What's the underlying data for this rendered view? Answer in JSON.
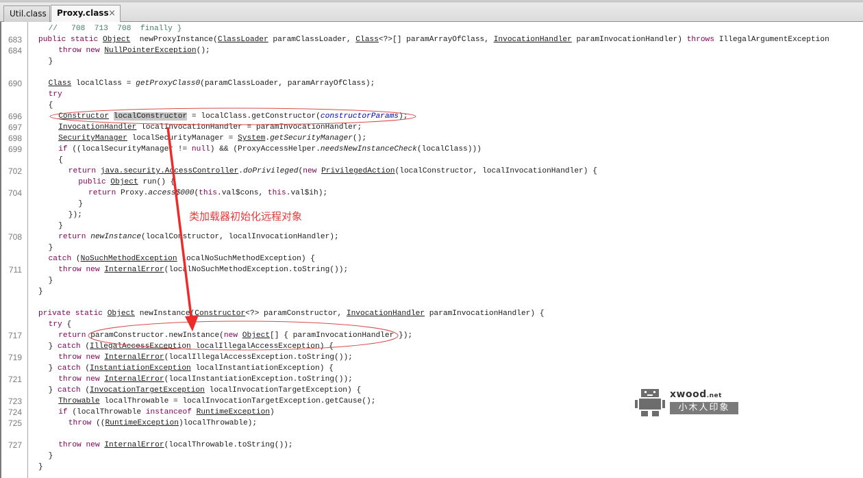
{
  "tabs": [
    {
      "label": "Util.class",
      "active": false
    },
    {
      "label": "Proxy.class",
      "active": true,
      "close_icon": "×"
    }
  ],
  "code_lines": [
    {
      "ln": "",
      "indent": 1,
      "tokens": [
        [
          "cm",
          "//   708  713  708  finally }"
        ]
      ]
    },
    {
      "ln": "683",
      "indent": 0,
      "tokens": [
        [
          "kw",
          "public static "
        ],
        [
          "ty",
          "Object"
        ],
        [
          "",
          "  newProxyInstance("
        ],
        [
          "ty",
          "ClassLoader"
        ],
        [
          "",
          " paramClassLoader, "
        ],
        [
          "ty",
          "Class"
        ],
        [
          "",
          "<?>[] paramArrayOfClass, "
        ],
        [
          "ty",
          "InvocationHandler"
        ],
        [
          "",
          " paramInvocationHandler) "
        ],
        [
          "kw",
          "throws"
        ],
        [
          "",
          " IllegalArgumentException"
        ]
      ]
    },
    {
      "ln": "684",
      "indent": 2,
      "tokens": [
        [
          "kw",
          "throw new "
        ],
        [
          "ty",
          "NullPointerException"
        ],
        [
          "",
          "();"
        ]
      ]
    },
    {
      "ln": "",
      "indent": 1,
      "tokens": [
        [
          "",
          "}"
        ]
      ]
    },
    {
      "ln": "",
      "indent": 0,
      "tokens": []
    },
    {
      "ln": "690",
      "indent": 1,
      "tokens": [
        [
          "ty",
          "Class"
        ],
        [
          "",
          " localClass = "
        ],
        [
          "it",
          "getProxyClass0"
        ],
        [
          "",
          "(paramClassLoader, paramArrayOfClass);"
        ]
      ]
    },
    {
      "ln": "",
      "indent": 1,
      "tokens": [
        [
          "kw",
          "try"
        ]
      ]
    },
    {
      "ln": "",
      "indent": 1,
      "tokens": [
        [
          "",
          "{"
        ]
      ]
    },
    {
      "ln": "696",
      "indent": 2,
      "tokens": [
        [
          "ty",
          "Constructor"
        ],
        [
          "",
          " "
        ],
        [
          "sel",
          "localConstructor"
        ],
        [
          "",
          " = localClass.getConstructor("
        ],
        [
          "fld",
          "constructorParams"
        ],
        [
          "",
          ");"
        ]
      ]
    },
    {
      "ln": "697",
      "indent": 2,
      "tokens": [
        [
          "ty",
          "InvocationHandler"
        ],
        [
          "",
          " localInvocationHandler = paramInvocationHandler;"
        ]
      ]
    },
    {
      "ln": "698",
      "indent": 2,
      "tokens": [
        [
          "ty",
          "SecurityManager"
        ],
        [
          "",
          " localSecurityManager = "
        ],
        [
          "ty",
          "System"
        ],
        [
          "",
          "."
        ],
        [
          "it",
          "getSecurityManager"
        ],
        [
          "",
          "();"
        ]
      ]
    },
    {
      "ln": "699",
      "indent": 2,
      "tokens": [
        [
          "kw",
          "if"
        ],
        [
          "",
          " ((localSecurityManager != "
        ],
        [
          "kw",
          "null"
        ],
        [
          "",
          ") && (ProxyAccessHelper."
        ],
        [
          "it",
          "needsNewInstanceCheck"
        ],
        [
          "",
          "(localClass)))"
        ]
      ]
    },
    {
      "ln": "",
      "indent": 2,
      "tokens": [
        [
          "",
          "{"
        ]
      ]
    },
    {
      "ln": "702",
      "indent": 3,
      "tokens": [
        [
          "kw",
          "return "
        ],
        [
          "ty",
          "java.security.AccessController"
        ],
        [
          "",
          "."
        ],
        [
          "it",
          "doPrivileged"
        ],
        [
          "",
          "("
        ],
        [
          "kw",
          "new "
        ],
        [
          "ty",
          "PrivilegedAction"
        ],
        [
          "",
          "(localConstructor, localInvocationHandler) {"
        ]
      ]
    },
    {
      "ln": "",
      "indent": 4,
      "tokens": [
        [
          "kw",
          "public "
        ],
        [
          "ty",
          "Object"
        ],
        [
          "",
          " run() {"
        ]
      ]
    },
    {
      "ln": "704",
      "indent": 5,
      "tokens": [
        [
          "kw",
          "return "
        ],
        [
          "",
          "Proxy."
        ],
        [
          "it",
          "access$000"
        ],
        [
          "",
          "("
        ],
        [
          "kw",
          "this"
        ],
        [
          "",
          ".val$cons, "
        ],
        [
          "kw",
          "this"
        ],
        [
          "",
          ".val$ih);"
        ]
      ]
    },
    {
      "ln": "",
      "indent": 4,
      "tokens": [
        [
          "",
          "}"
        ]
      ]
    },
    {
      "ln": "",
      "indent": 3,
      "tokens": [
        [
          "",
          "});"
        ]
      ]
    },
    {
      "ln": "",
      "indent": 2,
      "tokens": [
        [
          "",
          "}"
        ]
      ]
    },
    {
      "ln": "708",
      "indent": 2,
      "tokens": [
        [
          "kw",
          "return "
        ],
        [
          "it",
          "newInstance"
        ],
        [
          "",
          "(localConstructor, localInvocationHandler);"
        ]
      ]
    },
    {
      "ln": "",
      "indent": 1,
      "tokens": [
        [
          "",
          "}"
        ]
      ]
    },
    {
      "ln": "",
      "indent": 1,
      "tokens": [
        [
          "kw",
          "catch"
        ],
        [
          "",
          " ("
        ],
        [
          "ty",
          "NoSuchMethodException"
        ],
        [
          "",
          " localNoSuchMethodException) {"
        ]
      ]
    },
    {
      "ln": "711",
      "indent": 2,
      "tokens": [
        [
          "kw",
          "throw new "
        ],
        [
          "ty",
          "InternalError"
        ],
        [
          "",
          "(localNoSuchMethodException.toString());"
        ]
      ]
    },
    {
      "ln": "",
      "indent": 1,
      "tokens": [
        [
          "",
          "}"
        ]
      ]
    },
    {
      "ln": "",
      "indent": 0,
      "tokens": [
        [
          "",
          "}"
        ]
      ]
    },
    {
      "ln": "",
      "indent": 0,
      "tokens": []
    },
    {
      "ln": "",
      "indent": 0,
      "tokens": [
        [
          "kw",
          "private static "
        ],
        [
          "ty",
          "Object"
        ],
        [
          "",
          " newInstance("
        ],
        [
          "ty",
          "Constructor"
        ],
        [
          "",
          "<?> paramConstructor, "
        ],
        [
          "ty",
          "InvocationHandler"
        ],
        [
          "",
          " paramInvocationHandler) {"
        ]
      ]
    },
    {
      "ln": "",
      "indent": 1,
      "tokens": [
        [
          "kw",
          "try"
        ],
        [
          "",
          " {"
        ]
      ]
    },
    {
      "ln": "717",
      "indent": 2,
      "tokens": [
        [
          "kw",
          "return "
        ],
        [
          "",
          "paramConstructor.newInstance("
        ],
        [
          "kw",
          "new "
        ],
        [
          "ty",
          "Object"
        ],
        [
          "",
          "[] { paramInvocationHandler });"
        ]
      ]
    },
    {
      "ln": "",
      "indent": 1,
      "tokens": [
        [
          "",
          "} "
        ],
        [
          "kw",
          "catch"
        ],
        [
          "",
          " ("
        ],
        [
          "ty",
          "IllegalAccessException"
        ],
        [
          "",
          " localIllegalAccessException) {"
        ]
      ]
    },
    {
      "ln": "719",
      "indent": 2,
      "tokens": [
        [
          "kw",
          "throw new "
        ],
        [
          "ty",
          "InternalError"
        ],
        [
          "",
          "(localIllegalAccessException.toString());"
        ]
      ]
    },
    {
      "ln": "",
      "indent": 1,
      "tokens": [
        [
          "",
          "} "
        ],
        [
          "kw",
          "catch"
        ],
        [
          "",
          " ("
        ],
        [
          "ty",
          "InstantiationException"
        ],
        [
          "",
          " localInstantiationException) {"
        ]
      ]
    },
    {
      "ln": "721",
      "indent": 2,
      "tokens": [
        [
          "kw",
          "throw new "
        ],
        [
          "ty",
          "InternalError"
        ],
        [
          "",
          "(localInstantiationException.toString());"
        ]
      ]
    },
    {
      "ln": "",
      "indent": 1,
      "tokens": [
        [
          "",
          "} "
        ],
        [
          "kw",
          "catch"
        ],
        [
          "",
          " ("
        ],
        [
          "ty",
          "InvocationTargetException"
        ],
        [
          "",
          " localInvocationTargetException) {"
        ]
      ]
    },
    {
      "ln": "723",
      "indent": 2,
      "tokens": [
        [
          "ty",
          "Throwable"
        ],
        [
          "",
          " localThrowable = localInvocationTargetException.getCause();"
        ]
      ]
    },
    {
      "ln": "724",
      "indent": 2,
      "tokens": [
        [
          "kw",
          "if"
        ],
        [
          "",
          " (localThrowable "
        ],
        [
          "kw",
          "instanceof "
        ],
        [
          "ty",
          "RuntimeException"
        ],
        [
          "",
          ")"
        ]
      ]
    },
    {
      "ln": "725",
      "indent": 3,
      "tokens": [
        [
          "kw",
          "throw"
        ],
        [
          "",
          " (("
        ],
        [
          "ty",
          "RuntimeException"
        ],
        [
          "",
          ")localThrowable);"
        ]
      ]
    },
    {
      "ln": "",
      "indent": 0,
      "tokens": []
    },
    {
      "ln": "727",
      "indent": 2,
      "tokens": [
        [
          "kw",
          "throw new "
        ],
        [
          "ty",
          "InternalError"
        ],
        [
          "",
          "(localThrowable.toString());"
        ]
      ]
    },
    {
      "ln": "",
      "indent": 1,
      "tokens": [
        [
          "",
          "}"
        ]
      ]
    },
    {
      "ln": "",
      "indent": 0,
      "tokens": [
        [
          "",
          "}"
        ]
      ]
    }
  ],
  "annotation": {
    "text": "类加载器初始化远程对象",
    "color": "#e53a3a"
  },
  "watermark": {
    "brand": "xwood",
    "tld": ".net",
    "cn": "小木人印象"
  },
  "colors": {
    "keyword": "#7f0055",
    "comment": "#3f7f5f",
    "field": "#0000c0",
    "annotation": "#e53a3a"
  }
}
